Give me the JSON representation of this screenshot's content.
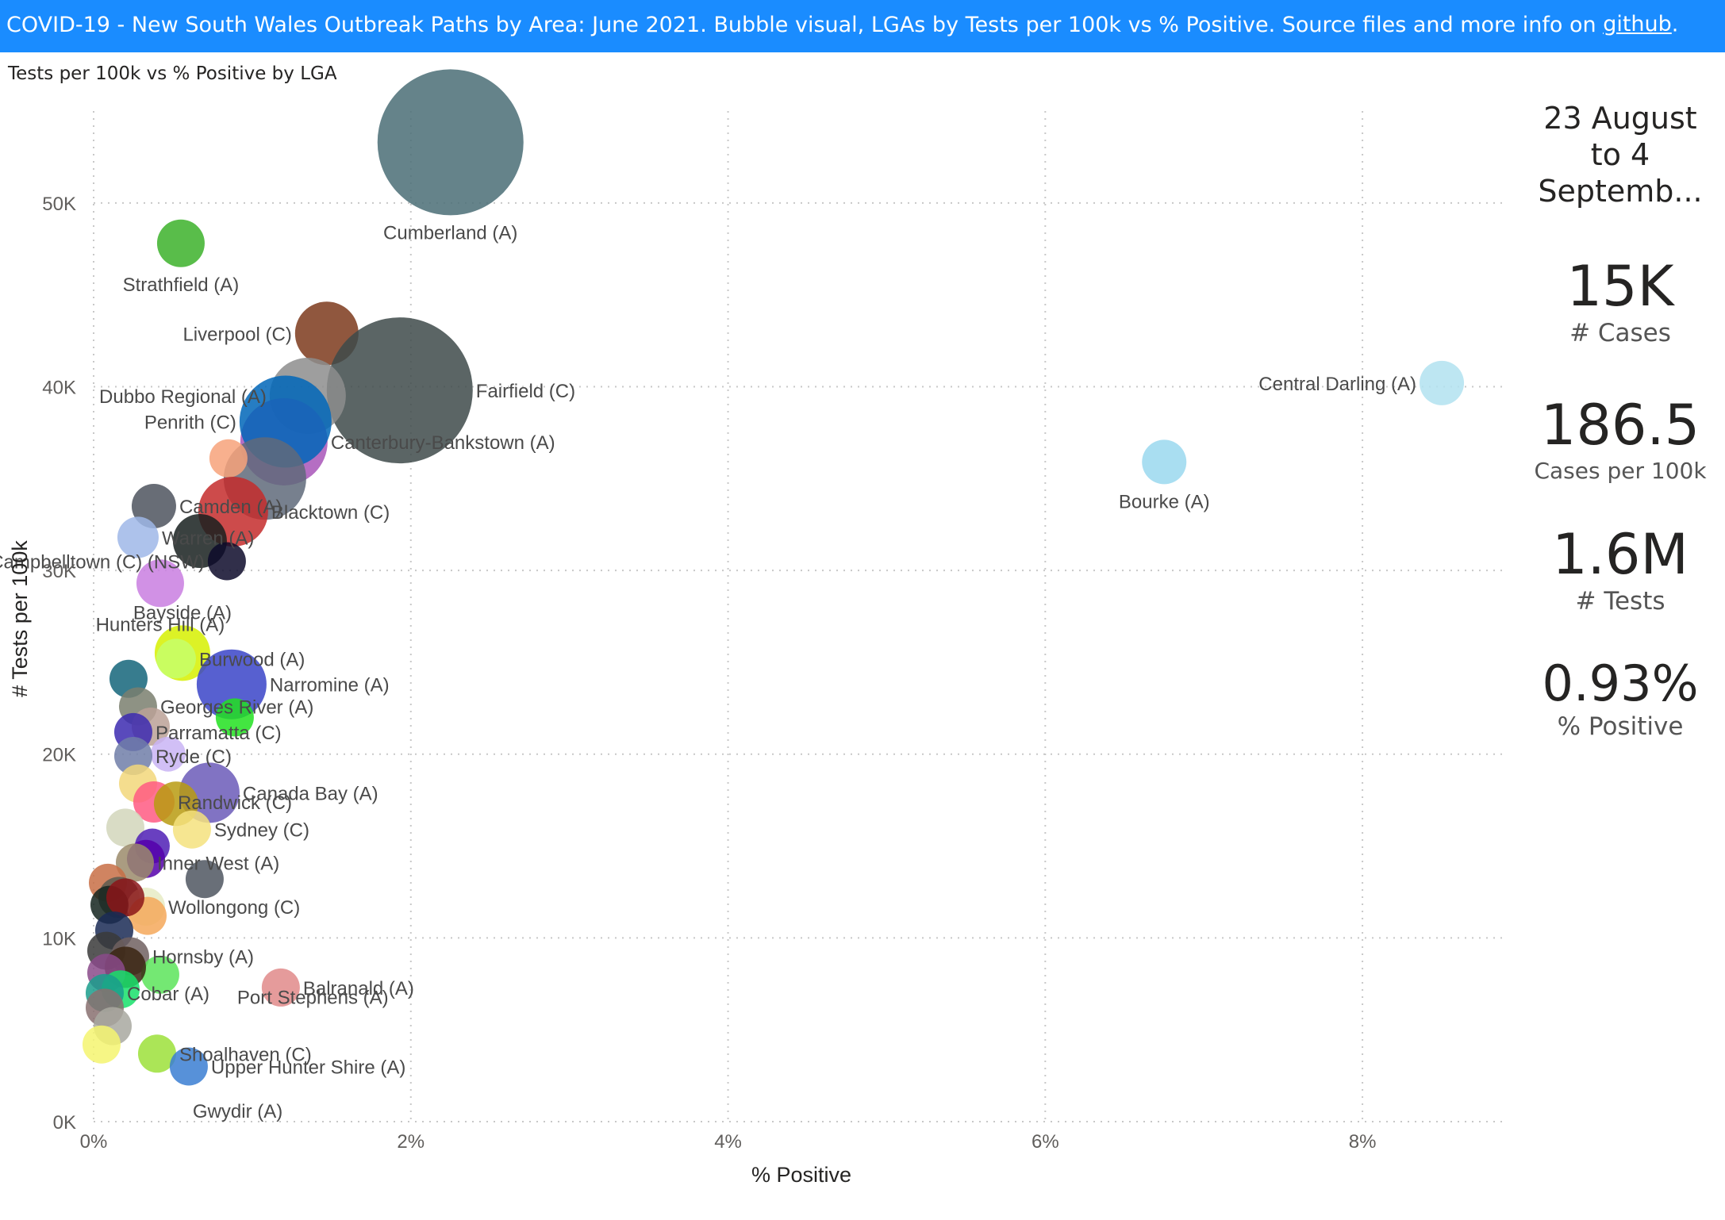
{
  "banner": {
    "text": "COVID-19  - New South Wales Outbreak Paths by Area: June 2021.  Bubble visual, LGAs by Tests per 100k vs % Positive. Source files and more info on ",
    "link": "github",
    "suffix": "."
  },
  "chart_title": "Tests per 100k vs % Positive by LGA",
  "kpis": {
    "date_range": [
      "23 August",
      "to 4",
      "Septemb..."
    ],
    "cases_value": "15K",
    "cases_label": "# Cases",
    "per100k_value": "186.5",
    "per100k_label": "Cases per 100k",
    "tests_value": "1.6M",
    "tests_label": "# Tests",
    "positive_value": "0.93%",
    "positive_label": "% Positive"
  },
  "colors": {
    "banner": "#1a8cff",
    "grid": "#c8c8c8",
    "text": "#252423"
  },
  "chart_data": {
    "type": "scatter",
    "title": "Tests per 100k vs % Positive by LGA",
    "xlabel": "% Positive",
    "ylabel": "# Tests per 100k",
    "xlim": [
      0,
      8.9
    ],
    "ylim": [
      0,
      55000
    ],
    "xticks": [
      {
        "v": 0,
        "t": "0%"
      },
      {
        "v": 2,
        "t": "2%"
      },
      {
        "v": 4,
        "t": "4%"
      },
      {
        "v": 6,
        "t": "6%"
      },
      {
        "v": 8,
        "t": "8%"
      }
    ],
    "yticks": [
      {
        "v": 0,
        "t": "0K"
      },
      {
        "v": 10000,
        "t": "10K"
      },
      {
        "v": 20000,
        "t": "20K"
      },
      {
        "v": 30000,
        "t": "30K"
      },
      {
        "v": 40000,
        "t": "40K"
      },
      {
        "v": 50000,
        "t": "50K"
      }
    ],
    "grid": true,
    "points": [
      {
        "x": 2.25,
        "y": 53300,
        "r": 92,
        "c": "#4a6d75",
        "label": "Cumberland (A)",
        "lp": "below"
      },
      {
        "x": 0.55,
        "y": 47800,
        "r": 30,
        "c": "#3cb22a",
        "label": "Strathfield (A)",
        "lp": "below"
      },
      {
        "x": 1.47,
        "y": 42900,
        "r": 40,
        "c": "#7c3a1c",
        "label": "Liverpool (C)",
        "lp": "left"
      },
      {
        "x": 1.93,
        "y": 39800,
        "r": 92,
        "c": "#3e4a4a",
        "label": "Fairfield (C)",
        "lp": "right"
      },
      {
        "x": 1.35,
        "y": 39500,
        "r": 48,
        "c": "#8d8d8d",
        "label": "Dubbo Regional (A)",
        "lp": "left"
      },
      {
        "x": 1.2,
        "y": 37000,
        "r": 55,
        "c": "#a855b8",
        "label": "Canterbury-Bankstown (A)",
        "lp": "right"
      },
      {
        "x": 1.21,
        "y": 38100,
        "r": 58,
        "c": "#0066b8",
        "label": "Penrith (C)",
        "lp": "left"
      },
      {
        "x": 1.08,
        "y": 35000,
        "r": 52,
        "c": "#5f6a7a",
        "label": "",
        "lp": "none"
      },
      {
        "x": 0.85,
        "y": 36100,
        "r": 24,
        "c": "#f7a27a",
        "label": "",
        "lp": "none"
      },
      {
        "x": 0.88,
        "y": 33200,
        "r": 44,
        "c": "#c42b2b",
        "label": "Blacktown (C)",
        "lp": "right"
      },
      {
        "x": 0.38,
        "y": 33500,
        "r": 28,
        "c": "#4d535e",
        "label": "Camden (A)",
        "lp": "right"
      },
      {
        "x": 0.67,
        "y": 31600,
        "r": 34,
        "c": "#17201e",
        "label": "",
        "lp": "none"
      },
      {
        "x": 0.84,
        "y": 30500,
        "r": 24,
        "c": "#0d0a2a",
        "label": "Campbelltown (C) (NSW)",
        "lp": "left"
      },
      {
        "x": 0.28,
        "y": 31800,
        "r": 26,
        "c": "#9fb7e8",
        "label": "Warren (A)",
        "lp": "right"
      },
      {
        "x": 0.42,
        "y": 29300,
        "r": 30,
        "c": "#c97ee0",
        "label": "Hunters Hill (A)",
        "lp": "below"
      },
      {
        "x": 0.56,
        "y": 25500,
        "r": 35,
        "c": "#d6f000",
        "label": "Bayside (A)",
        "lp": "above"
      },
      {
        "x": 0.87,
        "y": 23800,
        "r": 44,
        "c": "#3a44c8",
        "label": "Narromine (A)",
        "lp": "right"
      },
      {
        "x": 0.22,
        "y": 24100,
        "r": 24,
        "c": "#14657a",
        "label": "",
        "lp": "none"
      },
      {
        "x": 0.52,
        "y": 25200,
        "r": 25,
        "c": "#c6ff6b",
        "label": "Burwood (A)",
        "lp": "right"
      },
      {
        "x": 0.28,
        "y": 22600,
        "r": 24,
        "c": "#7a7f6e",
        "label": "Georges River (A)",
        "lp": "right"
      },
      {
        "x": 0.89,
        "y": 22000,
        "r": 24,
        "c": "#22e020",
        "label": "",
        "lp": "none"
      },
      {
        "x": 0.36,
        "y": 21500,
        "r": 24,
        "c": "#bba196",
        "label": "",
        "lp": "none"
      },
      {
        "x": 0.25,
        "y": 21200,
        "r": 24,
        "c": "#3c2ab0",
        "label": "Parramatta (C)",
        "lp": "right"
      },
      {
        "x": 0.47,
        "y": 20000,
        "r": 22,
        "c": "#c9b4f5",
        "label": "",
        "lp": "none"
      },
      {
        "x": 0.25,
        "y": 19900,
        "r": 24,
        "c": "#707ea8",
        "label": "Ryde (C)",
        "lp": "right"
      },
      {
        "x": 0.73,
        "y": 17900,
        "r": 38,
        "c": "#6b5ab8",
        "label": "Canada Bay (A)",
        "lp": "right"
      },
      {
        "x": 0.28,
        "y": 18400,
        "r": 24,
        "c": "#f2d77a",
        "label": "",
        "lp": "none"
      },
      {
        "x": 0.38,
        "y": 17400,
        "r": 26,
        "c": "#ff5a82",
        "label": "Randwick (C)",
        "lp": "right"
      },
      {
        "x": 0.52,
        "y": 17300,
        "r": 28,
        "c": "#b89b10",
        "label": "",
        "lp": "none"
      },
      {
        "x": 0.62,
        "y": 15900,
        "r": 24,
        "c": "#f5e27e",
        "label": "Sydney (C)",
        "lp": "right"
      },
      {
        "x": 0.2,
        "y": 16000,
        "r": 24,
        "c": "#d2d6bb",
        "label": "",
        "lp": "none"
      },
      {
        "x": 0.37,
        "y": 15000,
        "r": 22,
        "c": "#4f1fb5",
        "label": "",
        "lp": "none"
      },
      {
        "x": 0.33,
        "y": 14300,
        "r": 24,
        "c": "#5500aa",
        "label": "",
        "lp": "none"
      },
      {
        "x": 0.26,
        "y": 14100,
        "r": 24,
        "c": "#9b8b6b",
        "label": "Inner West (A)",
        "lp": "right"
      },
      {
        "x": 0.7,
        "y": 13200,
        "r": 24,
        "c": "#4f5660",
        "label": "",
        "lp": "none"
      },
      {
        "x": 0.09,
        "y": 13000,
        "r": 24,
        "c": "#c86e45",
        "label": "",
        "lp": "none"
      },
      {
        "x": 0.16,
        "y": 12200,
        "r": 26,
        "c": "#5a5a50",
        "label": "",
        "lp": "none"
      },
      {
        "x": 0.33,
        "y": 11700,
        "r": 24,
        "c": "#e6ebc4",
        "label": "Wollongong (C)",
        "lp": "right"
      },
      {
        "x": 0.1,
        "y": 11800,
        "r": 24,
        "c": "#14241e",
        "label": "",
        "lp": "none"
      },
      {
        "x": 0.34,
        "y": 11200,
        "r": 24,
        "c": "#f5a85a",
        "label": "",
        "lp": "none"
      },
      {
        "x": 0.2,
        "y": 12200,
        "r": 24,
        "c": "#8b1519",
        "label": "",
        "lp": "none"
      },
      {
        "x": 0.13,
        "y": 10400,
        "r": 24,
        "c": "#1a2a55",
        "label": "",
        "lp": "none"
      },
      {
        "x": 0.08,
        "y": 9300,
        "r": 24,
        "c": "#3a3a3a",
        "label": "",
        "lp": "none"
      },
      {
        "x": 0.23,
        "y": 9000,
        "r": 24,
        "c": "#706060",
        "label": "Hornsby (A)",
        "lp": "right"
      },
      {
        "x": 0.42,
        "y": 8000,
        "r": 24,
        "c": "#5ce45a",
        "label": "",
        "lp": "none"
      },
      {
        "x": 0.2,
        "y": 8400,
        "r": 26,
        "c": "#3a2412",
        "label": "",
        "lp": "none"
      },
      {
        "x": 0.08,
        "y": 8100,
        "r": 24,
        "c": "#8a4a8a",
        "label": "",
        "lp": "none"
      },
      {
        "x": 0.17,
        "y": 7200,
        "r": 24,
        "c": "#16e06a",
        "label": "",
        "lp": "none"
      },
      {
        "x": 0.07,
        "y": 7000,
        "r": 24,
        "c": "#1a9e8c",
        "label": "Cobar (A)",
        "lp": "right"
      },
      {
        "x": 0.07,
        "y": 6200,
        "r": 24,
        "c": "#887070",
        "label": "",
        "lp": "none"
      },
      {
        "x": 1.18,
        "y": 7300,
        "r": 24,
        "c": "#e08a8a",
        "label": "Balranald (A)",
        "lp": "right"
      },
      {
        "x": 0.88,
        "y": 6800,
        "r": 1,
        "c": "#ffffff",
        "label": "Port Stephens (A)",
        "lp": "right"
      },
      {
        "x": 0.12,
        "y": 5200,
        "r": 24,
        "c": "#a8a8a0",
        "label": "",
        "lp": "none"
      },
      {
        "x": 0.05,
        "y": 4200,
        "r": 24,
        "c": "#f4f470",
        "label": "",
        "lp": "none"
      },
      {
        "x": 0.4,
        "y": 3700,
        "r": 24,
        "c": "#9ce03a",
        "label": "Shoalhaven (C)",
        "lp": "right"
      },
      {
        "x": 0.6,
        "y": 3000,
        "r": 24,
        "c": "#3a7ed2",
        "label": "Upper Hunter Shire (A)",
        "lp": "right"
      },
      {
        "x": 0.6,
        "y": 600,
        "r": 1,
        "c": "#ffffff",
        "label": "Gwydir (A)",
        "lp": "right"
      },
      {
        "x": 6.75,
        "y": 35900,
        "r": 28,
        "c": "#9ad8ee",
        "label": "Bourke (A)",
        "lp": "below"
      },
      {
        "x": 8.5,
        "y": 40200,
        "r": 28,
        "c": "#b2e2f0",
        "label": "Central Darling (A)",
        "lp": "left"
      }
    ]
  }
}
